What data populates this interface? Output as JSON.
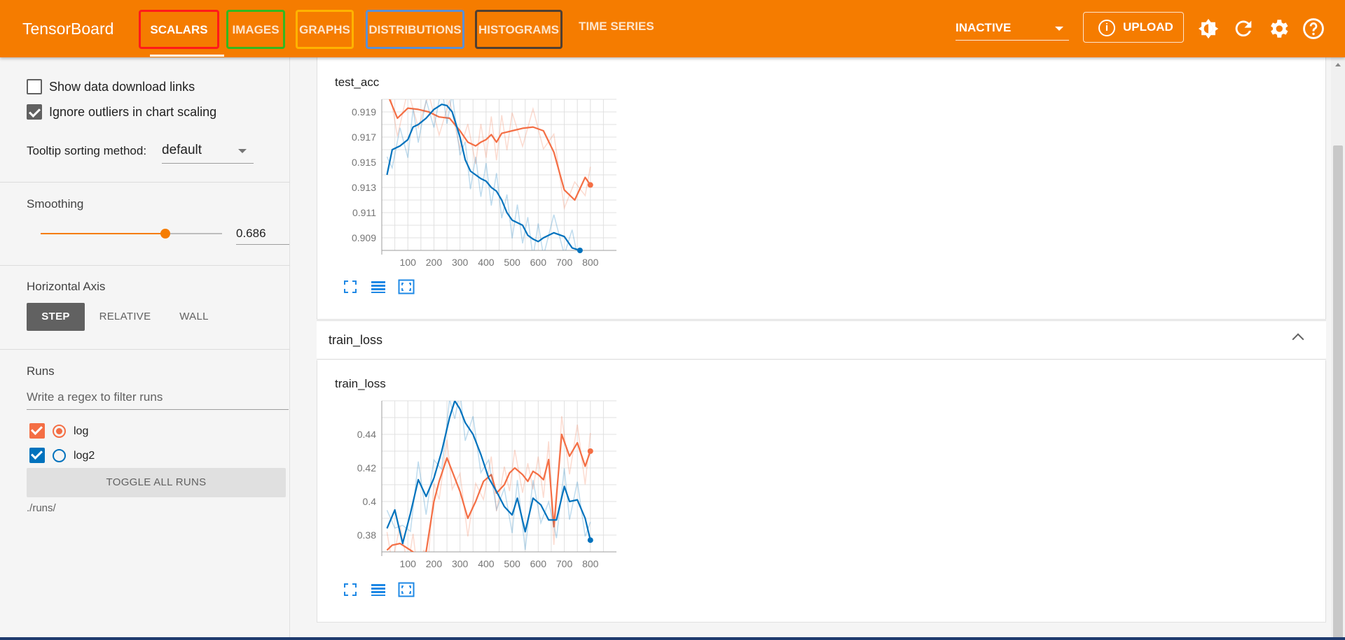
{
  "app": {
    "title": "TensorBoard"
  },
  "tabs": [
    {
      "label": "SCALARS",
      "outline": "#ff1a1a",
      "active": true
    },
    {
      "label": "IMAGES",
      "outline": "#33b81f"
    },
    {
      "label": "GRAPHS",
      "outline": "#ffb300"
    },
    {
      "label": "DISTRIBUTIONS",
      "outline": "#5a90d6"
    },
    {
      "label": "HISTOGRAMS",
      "outline": "#4f3f32"
    },
    {
      "label": "TIME SERIES"
    }
  ],
  "toolbar": {
    "status_select": "INACTIVE",
    "upload_label": "UPLOAD",
    "icons": [
      "theme-icon",
      "refresh-icon",
      "settings-icon",
      "help-icon"
    ]
  },
  "sidebar": {
    "show_download_links": {
      "label": "Show data download links",
      "checked": false
    },
    "ignore_outliers": {
      "label": "Ignore outliers in chart scaling",
      "checked": true
    },
    "tooltip_sorting": {
      "label": "Tooltip sorting method:",
      "value": "default"
    },
    "smoothing": {
      "label": "Smoothing",
      "value": "0.686",
      "fraction": 0.686
    },
    "horizontal_axis": {
      "label": "Horizontal Axis",
      "options": [
        "STEP",
        "RELATIVE",
        "WALL"
      ],
      "selected": "STEP"
    },
    "runs": {
      "label": "Runs",
      "filter_placeholder": "Write a regex to filter runs",
      "items": [
        {
          "name": "log",
          "checked": true,
          "selected": true,
          "color": "#f46e44"
        },
        {
          "name": "log2",
          "checked": true,
          "selected": false,
          "color": "#0072bd"
        }
      ],
      "toggle_all": "TOGGLE ALL RUNS",
      "logdir": "./runs/"
    }
  },
  "main": {
    "group_train_loss": "train_loss"
  },
  "colors": {
    "accent": "#f57c00",
    "run_log": "#f46e44",
    "run_log2": "#0072bd"
  },
  "chart_data": [
    {
      "type": "line",
      "title": "test_acc",
      "xlabel": "",
      "ylabel": "",
      "xlim": [
        0,
        900
      ],
      "ylim": [
        0.908,
        0.92
      ],
      "x_ticks": [
        100,
        200,
        300,
        400,
        500,
        600,
        700,
        800
      ],
      "y_ticks": [
        0.909,
        0.911,
        0.913,
        0.915,
        0.917,
        0.919
      ],
      "grid": true,
      "series": [
        {
          "name": "log",
          "color": "#f46e44",
          "x": [
            20,
            60,
            100,
            140,
            180,
            220,
            260,
            300,
            330,
            360,
            380,
            400,
            420,
            440,
            460,
            480,
            500,
            540,
            580,
            620,
            660,
            700,
            740,
            780,
            800
          ],
          "y": [
            0.9205,
            0.9185,
            0.9193,
            0.9192,
            0.919,
            0.9186,
            0.9185,
            0.9175,
            0.9166,
            0.9163,
            0.9166,
            0.9168,
            0.9172,
            0.9166,
            0.9173,
            0.9174,
            0.9175,
            0.9177,
            0.9178,
            0.9175,
            0.9158,
            0.9128,
            0.912,
            0.9138,
            0.9132
          ]
        },
        {
          "name": "log2",
          "color": "#0072bd",
          "x": [
            20,
            40,
            70,
            100,
            120,
            140,
            170,
            200,
            230,
            250,
            270,
            300,
            320,
            340,
            360,
            380,
            400,
            420,
            440,
            460,
            480,
            500,
            520,
            540,
            560,
            580,
            600,
            620,
            660,
            700,
            730,
            760
          ],
          "y": [
            0.914,
            0.916,
            0.9163,
            0.9168,
            0.9178,
            0.918,
            0.9185,
            0.9192,
            0.9196,
            0.9195,
            0.919,
            0.917,
            0.9152,
            0.9143,
            0.914,
            0.9137,
            0.9135,
            0.913,
            0.9127,
            0.912,
            0.911,
            0.9104,
            0.9102,
            0.91,
            0.9092,
            0.9089,
            0.9087,
            0.909,
            0.9094,
            0.9091,
            0.9082,
            0.908
          ]
        }
      ]
    },
    {
      "type": "line",
      "title": "train_loss",
      "xlabel": "",
      "ylabel": "",
      "xlim": [
        0,
        900
      ],
      "ylim": [
        0.37,
        0.46
      ],
      "x_ticks": [
        100,
        200,
        300,
        400,
        500,
        600,
        700,
        800
      ],
      "y_ticks": [
        0.38,
        0.4,
        0.42,
        0.44
      ],
      "y_tick_labels": [
        "0.38",
        "0.4",
        "0.42",
        "0.44"
      ],
      "grid": true,
      "series": [
        {
          "name": "log",
          "color": "#f46e44",
          "x": [
            20,
            40,
            70,
            100,
            120,
            140,
            160,
            180,
            200,
            220,
            250,
            270,
            300,
            330,
            360,
            390,
            420,
            440,
            470,
            490,
            510,
            540,
            560,
            580,
            600,
            620,
            640,
            660,
            690,
            720,
            750,
            780,
            800
          ],
          "y": [
            0.371,
            0.374,
            0.375,
            0.372,
            0.37,
            0.365,
            0.36,
            0.38,
            0.4,
            0.412,
            0.426,
            0.418,
            0.406,
            0.39,
            0.4,
            0.412,
            0.416,
            0.405,
            0.41,
            0.417,
            0.42,
            0.416,
            0.412,
            0.418,
            0.416,
            0.413,
            0.425,
            0.385,
            0.44,
            0.427,
            0.435,
            0.421,
            0.43
          ]
        },
        {
          "name": "log2",
          "color": "#0072bd",
          "x": [
            20,
            50,
            80,
            110,
            140,
            170,
            200,
            230,
            260,
            280,
            300,
            320,
            350,
            380,
            410,
            440,
            470,
            500,
            520,
            550,
            580,
            610,
            640,
            670,
            700,
            720,
            750,
            780,
            800
          ],
          "y": [
            0.384,
            0.395,
            0.375,
            0.393,
            0.413,
            0.403,
            0.414,
            0.43,
            0.45,
            0.46,
            0.455,
            0.447,
            0.44,
            0.428,
            0.414,
            0.406,
            0.397,
            0.392,
            0.402,
            0.382,
            0.402,
            0.398,
            0.389,
            0.389,
            0.409,
            0.4,
            0.401,
            0.39,
            0.377
          ]
        }
      ]
    }
  ]
}
